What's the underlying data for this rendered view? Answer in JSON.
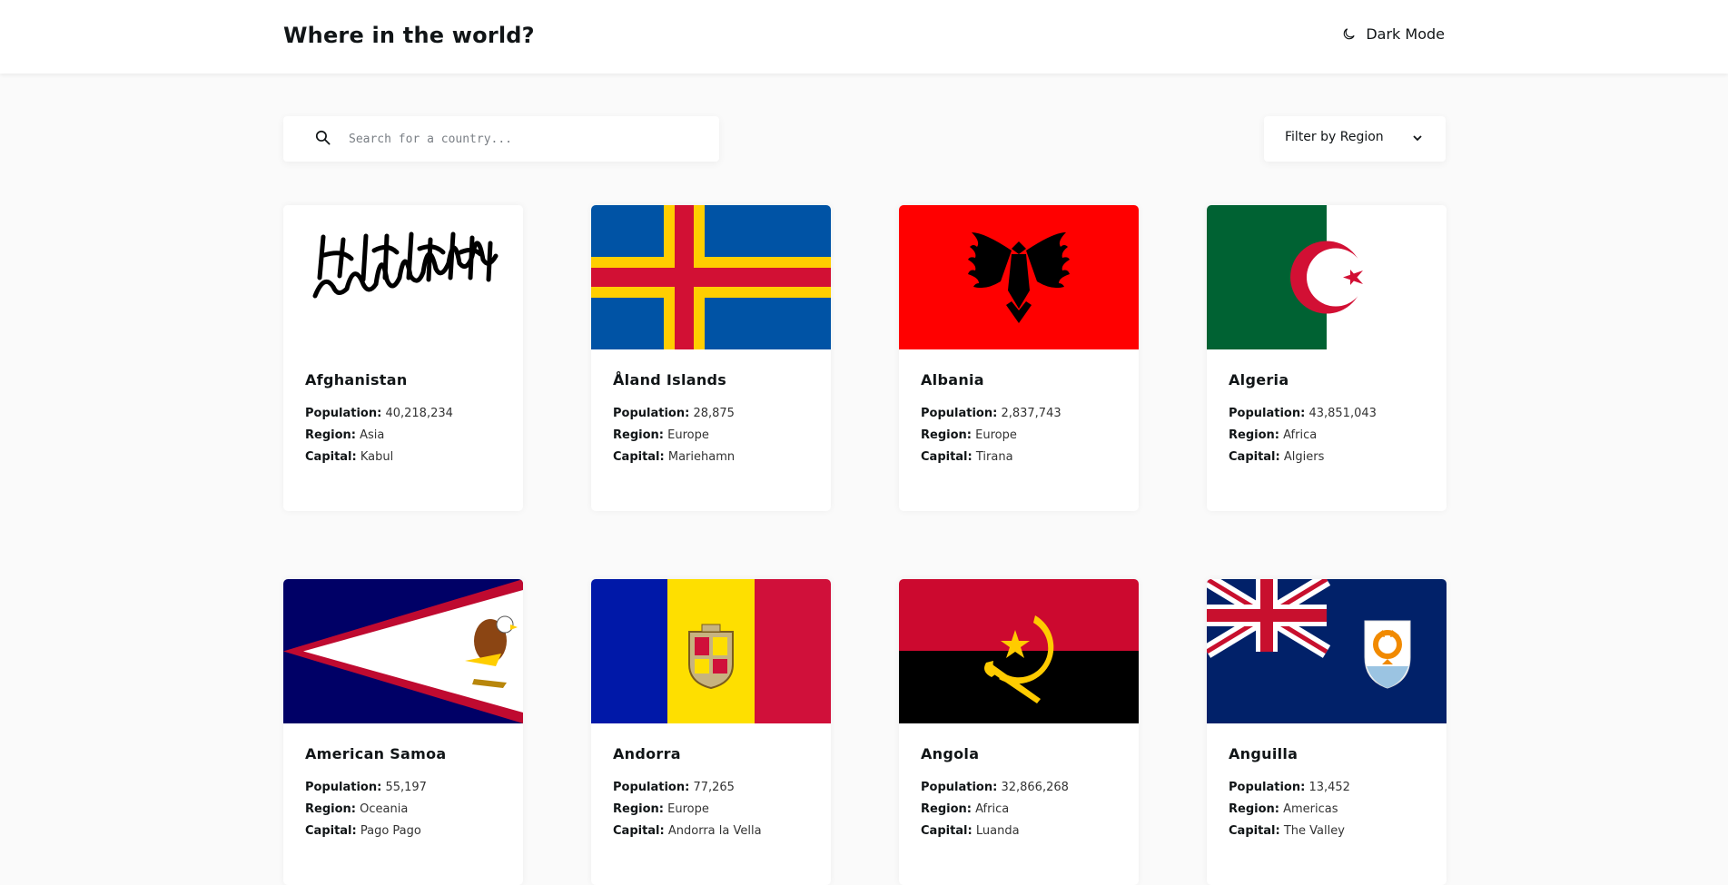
{
  "header": {
    "title": "Where in the world?",
    "mode_label": "Dark Mode"
  },
  "search": {
    "placeholder": "Search for a country..."
  },
  "filter": {
    "label": "Filter by Region"
  },
  "card_labels": {
    "population": "Population:",
    "region": "Region:",
    "capital": "Capital:"
  },
  "countries": [
    {
      "name": "Afghanistan",
      "population": "40,218,234",
      "region": "Asia",
      "capital": "Kabul",
      "flag": "afghanistan-flag"
    },
    {
      "name": "Åland Islands",
      "population": "28,875",
      "region": "Europe",
      "capital": "Mariehamn",
      "flag": "aland-flag"
    },
    {
      "name": "Albania",
      "population": "2,837,743",
      "region": "Europe",
      "capital": "Tirana",
      "flag": "albania-flag"
    },
    {
      "name": "Algeria",
      "population": "43,851,043",
      "region": "Africa",
      "capital": "Algiers",
      "flag": "algeria-flag"
    },
    {
      "name": "American Samoa",
      "population": "55,197",
      "region": "Oceania",
      "capital": "Pago Pago",
      "flag": "american-samoa-flag"
    },
    {
      "name": "Andorra",
      "population": "77,265",
      "region": "Europe",
      "capital": "Andorra la Vella",
      "flag": "andorra-flag"
    },
    {
      "name": "Angola",
      "population": "32,866,268",
      "region": "Africa",
      "capital": "Luanda",
      "flag": "angola-flag"
    },
    {
      "name": "Anguilla",
      "population": "13,452",
      "region": "Americas",
      "capital": "The Valley",
      "flag": "anguilla-flag"
    }
  ],
  "colors": {
    "background": "#fafafa",
    "card": "#ffffff",
    "text": "#111517"
  }
}
